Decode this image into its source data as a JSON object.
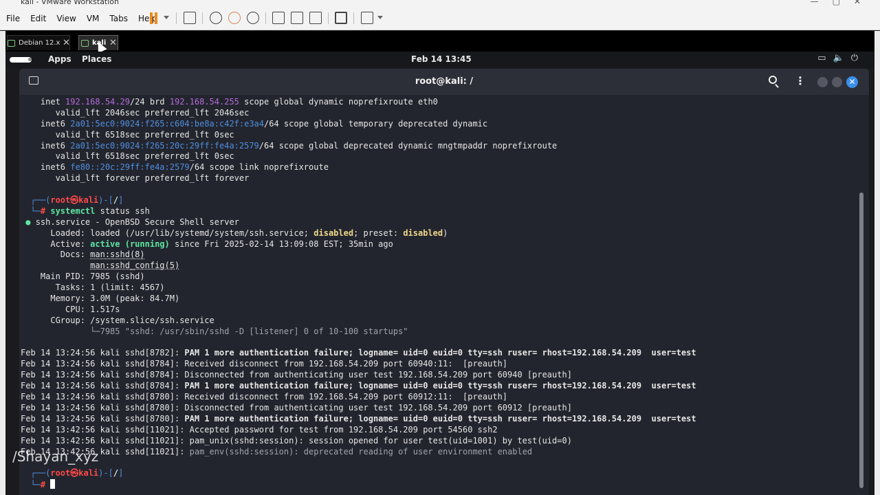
{
  "vmware": {
    "title": "kali - VMware Workstation",
    "menu": [
      "File",
      "Edit",
      "View",
      "VM",
      "Tabs",
      "Help"
    ],
    "tabs": [
      {
        "label": "Debian 12.x"
      },
      {
        "label": "kali"
      }
    ]
  },
  "panel": {
    "apps": "Apps",
    "places": "Places",
    "clock": "Feb 14  13:45",
    "icons": [
      "screen-icon",
      "volume-icon",
      "power-icon"
    ]
  },
  "terminal": {
    "title": "root@kali: /",
    "lines": [
      {
        "segs": [
          [
            "    inet ",
            ""
          ],
          [
            "192.168.54.29",
            "hl-purple"
          ],
          [
            "/24 brd ",
            ""
          ],
          [
            "192.168.54.255",
            "hl-purple"
          ],
          [
            " scope global dynamic noprefixroute eth0",
            ""
          ]
        ]
      },
      {
        "segs": [
          [
            "       valid_lft 2046sec preferred_lft 2046sec",
            ""
          ]
        ]
      },
      {
        "segs": [
          [
            "    inet6 ",
            ""
          ],
          [
            "2a01:5ec0:9024:f265:c604:be8a:c42f:e3a4",
            "hl-blue"
          ],
          [
            "/64 scope global temporary deprecated dynamic",
            ""
          ]
        ]
      },
      {
        "segs": [
          [
            "       valid_lft 6518sec preferred_lft 0sec",
            ""
          ]
        ]
      },
      {
        "segs": [
          [
            "    inet6 ",
            ""
          ],
          [
            "2a01:5ec0:9024:f265:20c:29ff:fe4a:2579",
            "hl-blue"
          ],
          [
            "/64 scope global deprecated dynamic mngtmpaddr noprefixroute",
            ""
          ]
        ]
      },
      {
        "segs": [
          [
            "       valid_lft 6518sec preferred_lft 0sec",
            ""
          ]
        ]
      },
      {
        "segs": [
          [
            "    inet6 ",
            ""
          ],
          [
            "fe80::20c:29ff:fe4a:2579",
            "hl-blue"
          ],
          [
            "/64 scope link noprefixroute",
            ""
          ]
        ]
      },
      {
        "segs": [
          [
            "       valid_lft forever preferred_lft forever",
            ""
          ]
        ]
      },
      {
        "segs": [
          [
            "",
            ""
          ]
        ]
      },
      {
        "segs": [
          [
            "  ┌──(",
            "hl-blue"
          ],
          [
            "root㉿kali",
            "hl-red"
          ],
          [
            ")-[",
            "hl-blue"
          ],
          [
            "/",
            "bold"
          ],
          [
            "]",
            "hl-blue"
          ]
        ]
      },
      {
        "segs": [
          [
            "  └─",
            "hl-blue"
          ],
          [
            "# ",
            "hl-red"
          ],
          [
            "systemctl",
            "hl-green"
          ],
          [
            " status ssh",
            ""
          ]
        ]
      },
      {
        "segs": [
          [
            " ● ",
            "hl-green"
          ],
          [
            "ssh.service - OpenBSD Secure Shell server",
            ""
          ]
        ]
      },
      {
        "segs": [
          [
            "      Loaded: loaded (/usr/lib/systemd/system/ssh.service; ",
            ""
          ],
          [
            "disabled",
            "hl-yellow"
          ],
          [
            "; preset: ",
            ""
          ],
          [
            "disabled",
            "hl-yellow"
          ],
          [
            ")",
            ""
          ]
        ]
      },
      {
        "segs": [
          [
            "      Active: ",
            ""
          ],
          [
            "active (running)",
            "hl-green"
          ],
          [
            " since Fri 2025-02-14 13:09:08 EST; 35min ago",
            ""
          ]
        ]
      },
      {
        "segs": [
          [
            "        Docs: ",
            ""
          ],
          [
            "man:sshd(8)",
            "ul"
          ]
        ]
      },
      {
        "segs": [
          [
            "              ",
            ""
          ],
          [
            "man:sshd_config(5)",
            "ul"
          ]
        ]
      },
      {
        "segs": [
          [
            "    Main PID: 7985 (sshd)",
            ""
          ]
        ]
      },
      {
        "segs": [
          [
            "       Tasks: 1 (limit: 4567)",
            ""
          ]
        ]
      },
      {
        "segs": [
          [
            "      Memory: 3.0M (peak: 84.7M)",
            ""
          ]
        ]
      },
      {
        "segs": [
          [
            "         CPU: 1.517s",
            ""
          ]
        ]
      },
      {
        "segs": [
          [
            "      CGroup: /system.slice/ssh.service",
            ""
          ]
        ]
      },
      {
        "segs": [
          [
            "              └─7985 \"sshd: /usr/sbin/sshd -D [listener] 0 of 10-100 startups\"",
            "hl-dim"
          ]
        ]
      },
      {
        "segs": [
          [
            "",
            ""
          ]
        ]
      },
      {
        "segs": [
          [
            "Feb 14 13:24:56 kali sshd[8782]: ",
            ""
          ],
          [
            "PAM 1 more authentication failure; logname= uid=0 euid=0 tty=ssh ruser= rhost=192.168.54.209  user=test",
            "bold"
          ]
        ]
      },
      {
        "segs": [
          [
            "Feb 14 13:24:56 kali sshd[8784]: Received disconnect from 192.168.54.209 port 60940:11:  [preauth]",
            ""
          ]
        ]
      },
      {
        "segs": [
          [
            "Feb 14 13:24:56 kali sshd[8784]: Disconnected from authenticating user test 192.168.54.209 port 60940 [preauth]",
            ""
          ]
        ]
      },
      {
        "segs": [
          [
            "Feb 14 13:24:56 kali sshd[8784]: ",
            ""
          ],
          [
            "PAM 1 more authentication failure; logname= uid=0 euid=0 tty=ssh ruser= rhost=192.168.54.209  user=test",
            "bold"
          ]
        ]
      },
      {
        "segs": [
          [
            "Feb 14 13:24:56 kali sshd[8780]: Received disconnect from 192.168.54.209 port 60912:11:  [preauth]",
            ""
          ]
        ]
      },
      {
        "segs": [
          [
            "Feb 14 13:24:56 kali sshd[8780]: Disconnected from authenticating user test 192.168.54.209 port 60912 [preauth]",
            ""
          ]
        ]
      },
      {
        "segs": [
          [
            "Feb 14 13:24:56 kali sshd[8780]: ",
            ""
          ],
          [
            "PAM 1 more authentication failure; logname= uid=0 euid=0 tty=ssh ruser= rhost=192.168.54.209  user=test",
            "bold"
          ]
        ]
      },
      {
        "segs": [
          [
            "Feb 14 13:42:56 kali sshd[11021]: Accepted password for test from 192.168.54.209 port 54560 ssh2",
            ""
          ]
        ]
      },
      {
        "segs": [
          [
            "Feb 14 13:42:56 kali sshd[11021]: pam_unix(sshd:session): session opened for user test(uid=1001) by test(uid=0)",
            ""
          ]
        ]
      },
      {
        "segs": [
          [
            "Feb 14 13:42:56 kali sshd[11021]: ",
            ""
          ],
          [
            "pam_env(sshd:session): deprecated reading of user environment enabled",
            "hl-dim"
          ]
        ]
      },
      {
        "segs": [
          [
            "",
            ""
          ]
        ]
      },
      {
        "segs": [
          [
            "  ┌──(",
            "hl-blue"
          ],
          [
            "root㉿kali",
            "hl-red"
          ],
          [
            ")-[",
            "hl-blue"
          ],
          [
            "/",
            "bold"
          ],
          [
            "]",
            "hl-blue"
          ]
        ]
      },
      {
        "segs": [
          [
            "  └─",
            "hl-blue"
          ],
          [
            "# ",
            "hl-red"
          ]
        ],
        "cursor": true
      }
    ]
  },
  "watermark": "/Shayan_xyz"
}
